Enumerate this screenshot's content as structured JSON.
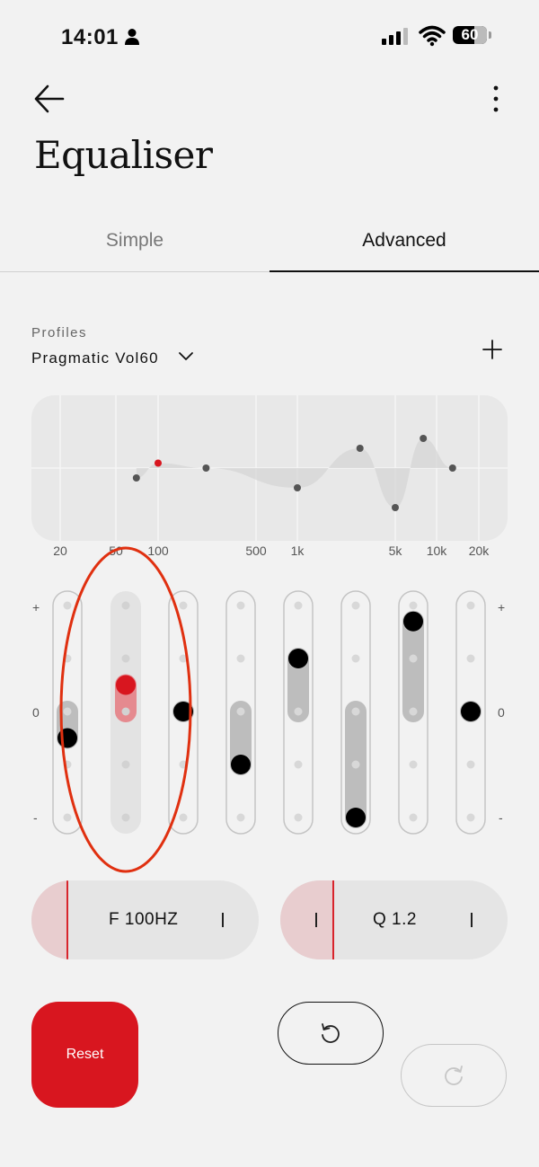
{
  "status": {
    "time": "14:01",
    "battery": "60"
  },
  "header": {
    "title": "Equaliser"
  },
  "tabs": [
    {
      "label": "Simple"
    },
    {
      "label": "Advanced"
    }
  ],
  "profiles": {
    "label": "Profiles",
    "value": "Pragmatic Vol60"
  },
  "graph": {
    "freq_labels": [
      "20",
      "50",
      "100",
      "500",
      "1k",
      "5k",
      "10k",
      "20k"
    ],
    "bands": [
      {
        "freq": 70,
        "gain": -1,
        "selected": false
      },
      {
        "freq": 100,
        "gain": 0.5,
        "selected": true
      },
      {
        "freq": 220,
        "gain": 0,
        "selected": false
      },
      {
        "freq": 1000,
        "gain": -2,
        "selected": false
      },
      {
        "freq": 2800,
        "gain": 2,
        "selected": false
      },
      {
        "freq": 5000,
        "gain": -4,
        "selected": false
      },
      {
        "freq": 8000,
        "gain": 3,
        "selected": false
      },
      {
        "freq": 13000,
        "gain": 0,
        "selected": false
      }
    ]
  },
  "sliders": {
    "plus_label": "+",
    "zero_label": "0",
    "minus_label": "-",
    "levels": [
      -0.5,
      0.5,
      0,
      -1,
      1,
      -2,
      1.7,
      0
    ],
    "selected_index": 1
  },
  "frequency_pill": {
    "label": "F 100HZ"
  },
  "q_pill": {
    "label": "Q 1.2"
  },
  "buttons": {
    "reset": "Reset"
  },
  "colors": {
    "accent": "#d8161f",
    "background": "#f2f2f2"
  }
}
